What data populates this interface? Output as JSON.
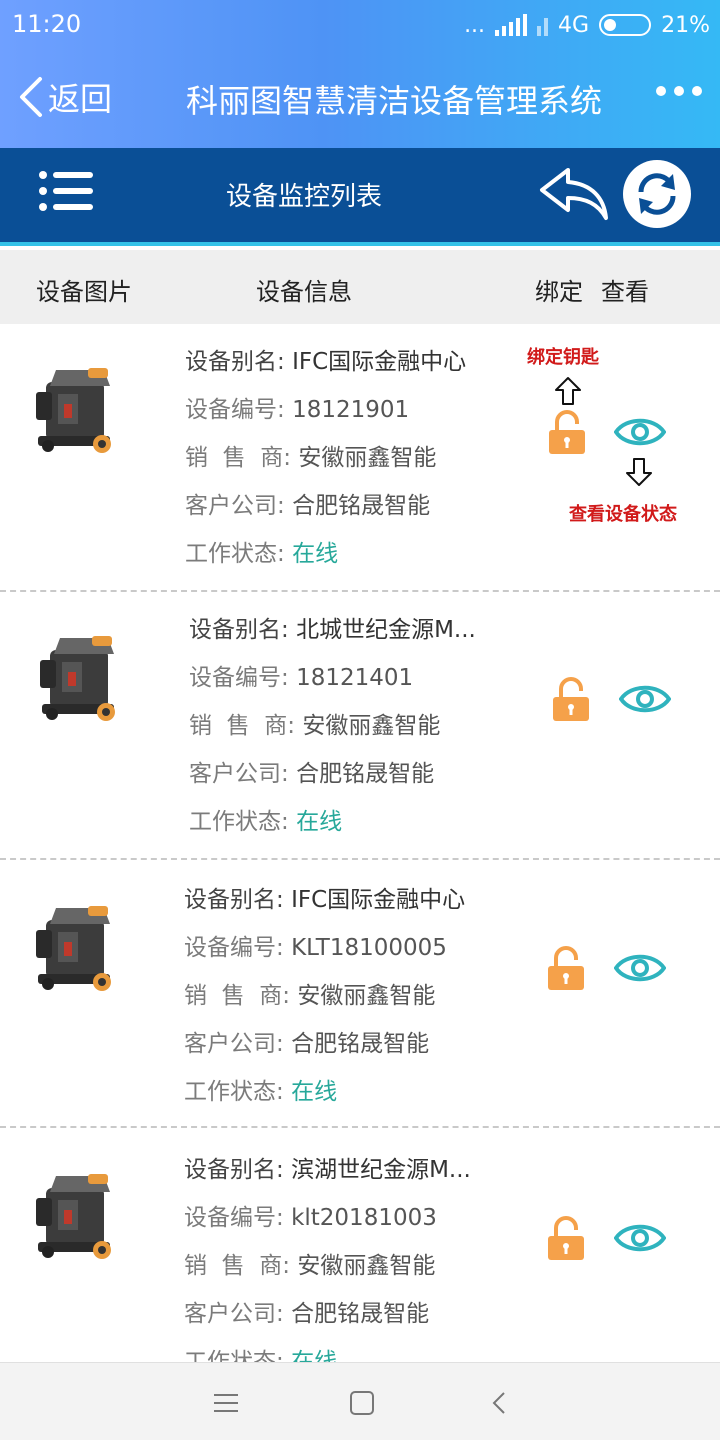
{
  "status": {
    "time": "11:20",
    "dots": "...",
    "network": "4G",
    "battery": "21%"
  },
  "header": {
    "back_label": "返回",
    "title": "科丽图智慧清洁设备管理系统"
  },
  "subheader": {
    "title": "设备监控列表"
  },
  "columns": {
    "image": "设备图片",
    "info": "设备信息",
    "bind": "绑定",
    "view": "查看"
  },
  "labels": {
    "alias": "设备别名:",
    "number": "设备编号:",
    "dealer": "销  售  商:",
    "company": "客户公司:",
    "state": "工作状态:"
  },
  "annotations": {
    "bind_key": "绑定钥匙",
    "view_status": "查看设备状态"
  },
  "devices": [
    {
      "alias": "IFC国际金融中心",
      "number": "18121901",
      "dealer": "安徽丽鑫智能",
      "company": "合肥铭晟智能",
      "state": "在线"
    },
    {
      "alias": "北城世纪金源M...",
      "number": "18121401",
      "dealer": "安徽丽鑫智能",
      "company": "合肥铭晟智能",
      "state": "在线"
    },
    {
      "alias": "IFC国际金融中心",
      "number": "KLT18100005",
      "dealer": "安徽丽鑫智能",
      "company": "合肥铭晟智能",
      "state": "在线"
    },
    {
      "alias": "滨湖世纪金源M...",
      "number": "klt20181003",
      "dealer": "安徽丽鑫智能",
      "company": "合肥铭晟智能",
      "state": "在线"
    }
  ],
  "colors": {
    "header_dark": "#0a4f96",
    "accent_cyan": "#34c2e8",
    "lock_orange": "#f5a14a",
    "eye_teal": "#2fb3be",
    "online_green": "#27a89a",
    "annotation_red": "#d11a1a"
  },
  "icons": [
    "back-chevron-icon",
    "more-dots-icon",
    "menu-list-icon",
    "reply-arrow-icon",
    "refresh-icon",
    "unlock-icon",
    "eye-icon",
    "nav-menu-icon",
    "nav-home-icon",
    "nav-back-icon"
  ]
}
